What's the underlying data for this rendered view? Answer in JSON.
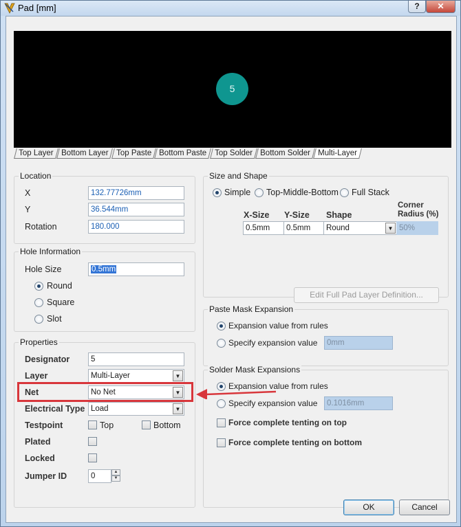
{
  "window": {
    "title": "Pad [mm]",
    "help_glyph": "?",
    "close_glyph": "✕"
  },
  "preview": {
    "pad_label": "5",
    "pad_color": "#0f9690",
    "background": "#000000",
    "layer_tabs": [
      "Top Layer",
      "Bottom Layer",
      "Top Paste",
      "Bottom Paste",
      "Top Solder",
      "Bottom Solder",
      "Multi-Layer"
    ],
    "active_tab": "Multi-Layer"
  },
  "location": {
    "legend": "Location",
    "x_label": "X",
    "x_value": "132.77726mm",
    "y_label": "Y",
    "y_value": "36.544mm",
    "rotation_label": "Rotation",
    "rotation_value": "180.000"
  },
  "hole": {
    "legend": "Hole Information",
    "size_label": "Hole Size",
    "size_value": "0.5mm",
    "options": [
      "Round",
      "Square",
      "Slot"
    ],
    "selected": "Round"
  },
  "properties": {
    "legend": "Properties",
    "designator_label": "Designator",
    "designator_value": "5",
    "layer_label": "Layer",
    "layer_value": "Multi-Layer",
    "net_label": "Net",
    "net_value": "No Net",
    "electrical_label": "Electrical Type",
    "electrical_value": "Load",
    "testpoint_label": "Testpoint",
    "testpoint_top": "Top",
    "testpoint_bottom": "Bottom",
    "plated_label": "Plated",
    "locked_label": "Locked",
    "jumper_label": "Jumper ID",
    "jumper_value": "0"
  },
  "size_shape": {
    "legend": "Size and Shape",
    "modes": [
      "Simple",
      "Top-Middle-Bottom",
      "Full Stack"
    ],
    "selected_mode": "Simple",
    "col_xsize": "X-Size",
    "col_ysize": "Y-Size",
    "col_shape": "Shape",
    "col_corner_1": "Corner",
    "col_corner_2": "Radius (%)",
    "row_xsize": "0.5mm",
    "row_ysize": "0.5mm",
    "row_shape": "Round",
    "row_corner": "50%",
    "edit_button": "Edit Full Pad Layer Definition..."
  },
  "paste_mask": {
    "legend": "Paste Mask Expansion",
    "opt_rules": "Expansion value from rules",
    "opt_specify": "Specify expansion value",
    "value": "0mm"
  },
  "solder_mask": {
    "legend": "Solder Mask Expansions",
    "opt_rules": "Expansion value from rules",
    "opt_specify": "Specify expansion value",
    "value": "0.1016mm",
    "tent_top": "Force complete tenting on top",
    "tent_bottom": "Force complete tenting on bottom"
  },
  "buttons": {
    "ok": "OK",
    "cancel": "Cancel"
  },
  "annotation": {
    "color": "#d8363b"
  },
  "accent_field_color": "#b9d1ea"
}
